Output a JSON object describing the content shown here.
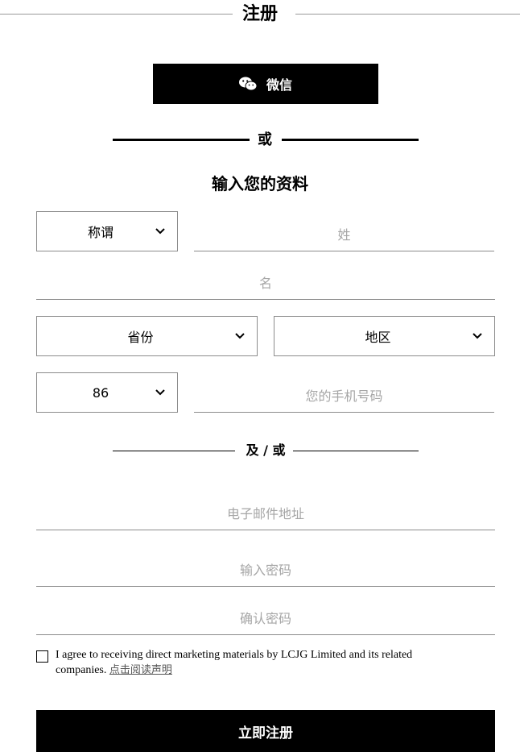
{
  "header": {
    "title": "注册"
  },
  "wechat": {
    "label": "微信",
    "icon": "wechat-icon"
  },
  "divider_or": {
    "text": "或"
  },
  "form": {
    "subtitle": "输入您的资料",
    "salutation": {
      "value": "称谓"
    },
    "surname": {
      "placeholder": "姓"
    },
    "given_name": {
      "placeholder": "名"
    },
    "province": {
      "value": "省份"
    },
    "region": {
      "value": "地区"
    },
    "country_code": {
      "value": "86"
    },
    "phone": {
      "placeholder": "您的手机号码"
    },
    "and_or": {
      "text": "及 / 或"
    },
    "email": {
      "placeholder": "电子邮件地址"
    },
    "password": {
      "placeholder": "输入密码"
    },
    "confirm_password": {
      "placeholder": "确认密码"
    },
    "consent": {
      "text": "I agree to receiving direct marketing materials by LCJG Limited and its related companies.",
      "link": "点击阅读声明",
      "checked": false
    },
    "submit_label": "立即注册"
  },
  "colors": {
    "primary": "#000000",
    "border": "#8c8c8c",
    "placeholder": "#a6a6a6",
    "background": "#ffffff"
  }
}
